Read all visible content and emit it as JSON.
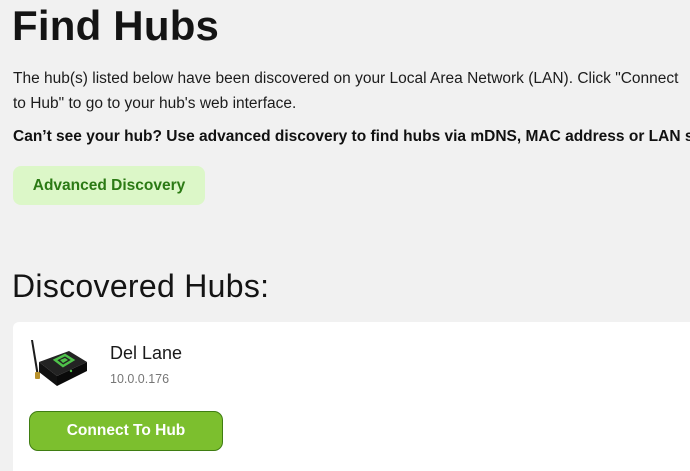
{
  "page": {
    "title": "Find Hubs",
    "intro": "The hub(s) listed below have been discovered on your Local Area Network (LAN). Click \"Connect to Hub\" to go to your hub's web interface.",
    "hint": "Can’t see your hub? Use advanced discovery to find hubs via mDNS, MAC address or LAN scan.",
    "advanced_discovery_label": "Advanced Discovery"
  },
  "discovered": {
    "heading": "Discovered Hubs:",
    "hubs": [
      {
        "name": "Del Lane",
        "ip": "10.0.0.176",
        "connect_label": "Connect To Hub",
        "icon": "hub-device-icon"
      }
    ]
  },
  "colors": {
    "background": "#f1f1f1",
    "advanced_button_bg": "#dcf7c8",
    "advanced_button_text": "#2b7a14",
    "connect_button_bg": "#7cbf2e",
    "connect_button_border": "#3f7d12",
    "card_bg": "#ffffff"
  }
}
